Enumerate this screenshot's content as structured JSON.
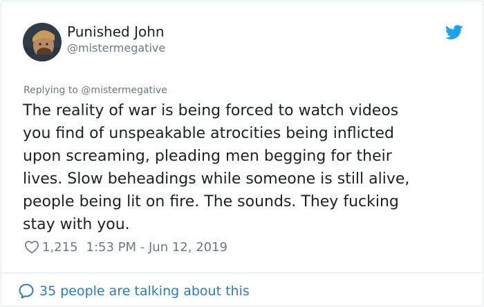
{
  "tweet": {
    "author": {
      "display_name": "Punished John",
      "handle": "@mistermegative",
      "avatar_icon": "avatar-photo"
    },
    "replying_to": "Replying to @mistermegative",
    "text": "The reality of war is being forced to watch videos\nyou find of unspeakable atrocities being inflicted\nupon screaming, pleading men begging for their\nlives. Slow beheadings while someone is still alive,\npeople being lit on fire. The sounds. They fucking\nstay with you.",
    "likes": "1,215",
    "timestamp": "1:53 PM - Jun 12, 2019",
    "conversation_link": "35 people are talking about this"
  },
  "icons": {
    "brand": "twitter-bird-icon",
    "like": "heart-icon",
    "conversation": "speech-bubble-icon"
  },
  "colors": {
    "twitter_blue": "#1da1f2",
    "link_blue": "#2b7bb9",
    "muted_gray": "#697882",
    "text_dark": "#1c2022",
    "border": "#e1e8ed"
  }
}
